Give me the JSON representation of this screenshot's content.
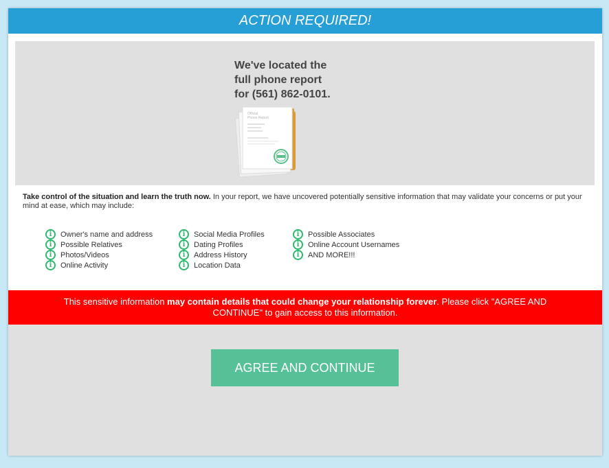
{
  "header": {
    "title": "ACTION REQUIRED!"
  },
  "hero": {
    "lines": [
      "We've located the",
      "full phone report",
      "for (561) 862-0101."
    ],
    "document": {
      "title_line1": "Official",
      "title_line2": "Phone Report"
    }
  },
  "intro": {
    "bold": "Take control of the situation and learn the truth now.",
    "rest": " In your report, we have uncovered potentially sensitive information that may validate your concerns or put your mind at ease, which may include:"
  },
  "features": {
    "col1": [
      "Owner's name and address",
      "Possible Relatives",
      "Photos/Videos",
      "Online Activity"
    ],
    "col2": [
      "Social Media Profiles",
      "Dating Profiles",
      "Address History",
      "Location Data"
    ],
    "col3": [
      "Possible Associates",
      "Online Account Usernames",
      "AND MORE!!!"
    ]
  },
  "warning": {
    "part1": "This sensitive information ",
    "bold": "may contain details that could change your relationship forever",
    "part2": ". Please click \"AGREE AND CONTINUE\" to gain access to this information."
  },
  "cta": {
    "label": "AGREE AND CONTINUE"
  },
  "colors": {
    "header": "#259fd6",
    "warning": "#ff0000",
    "button": "#56c196",
    "icon": "#2eb86e"
  }
}
